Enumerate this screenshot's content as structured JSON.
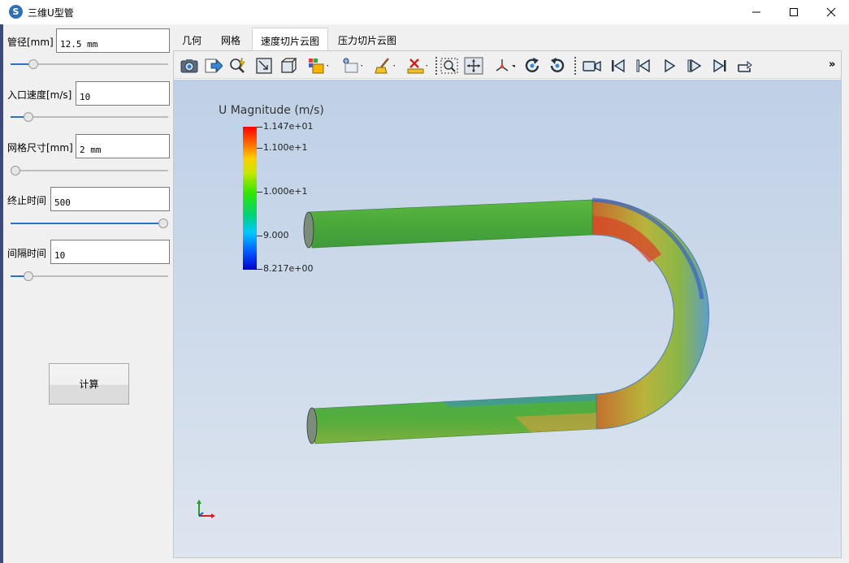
{
  "window": {
    "title": "三维U型管",
    "app_icon_glyph": "S",
    "controls": [
      "minimize-icon",
      "maximize-icon",
      "close-icon"
    ]
  },
  "params": {
    "pipe_diameter": {
      "label": "管径[mm]",
      "value": "12.5 mm",
      "slider_fraction": 0.12
    },
    "inlet_velocity": {
      "label": "入口速度[m/s]",
      "value": "10",
      "slider_fraction": 0.09
    },
    "mesh_size": {
      "label": "网格尺寸[mm]",
      "value": "2 mm",
      "slider_fraction": 0.0
    },
    "end_time": {
      "label": "终止时间",
      "value": "500",
      "slider_fraction": 1.0
    },
    "interval_time": {
      "label": "间隔时间",
      "value": "10",
      "slider_fraction": 0.09
    },
    "compute_label": "计算"
  },
  "tabs": [
    {
      "label": "几何",
      "active": false
    },
    {
      "label": "网格",
      "active": false
    },
    {
      "label": "速度切片云图",
      "active": true
    },
    {
      "label": "压力切片云图",
      "active": false
    }
  ],
  "toolbar": {
    "overflow_label": "»",
    "buttons": [
      "camera-icon",
      "export-icon",
      "pick-icon",
      "zoom-box-icon",
      "box-icon",
      "colormap-icon",
      "slice-icon",
      "sweep-icon",
      "ruler-icon",
      "zoom-fit-icon",
      "recenter-icon",
      "axes-icon",
      "rotate-cw-icon",
      "rotate-ccw-icon",
      "video-icon",
      "first-frame-icon",
      "prev-frame-icon",
      "play-icon",
      "next-frame-icon",
      "last-frame-icon",
      "loop-icon"
    ]
  },
  "legend": {
    "title": "U Magnitude (m/s)",
    "max": "1.147e+01",
    "mid_high": "1.100e+1",
    "mid": "1.000e+1",
    "low": "9.000",
    "min": "8.217e+00"
  },
  "colors": {
    "bg_top": "#bfd0e6",
    "bg_bottom": "#dde5ef",
    "pipe_green": "#4aa83a",
    "hot": "#d8442a",
    "cold": "#3a74c8",
    "accent": "#2a72c8"
  }
}
